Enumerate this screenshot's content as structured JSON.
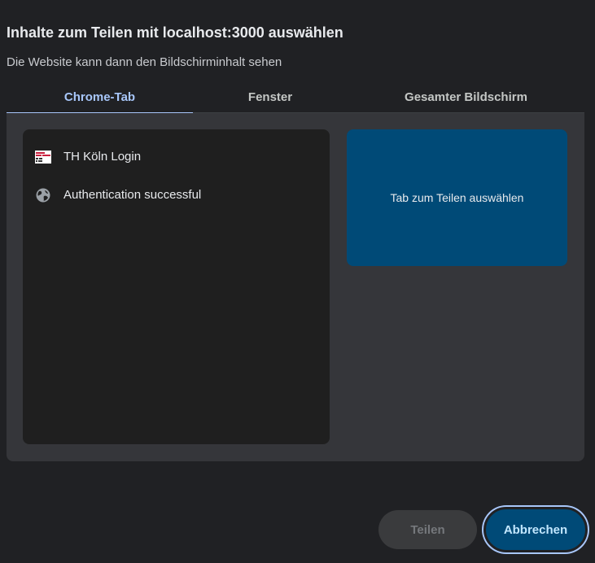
{
  "dialog": {
    "title": "Inhalte zum Teilen mit localhost:3000 auswählen",
    "subtitle": "Die Website kann dann den Bildschirminhalt sehen"
  },
  "tabs": [
    {
      "label": "Chrome-Tab",
      "active": true
    },
    {
      "label": "Fenster",
      "active": false
    },
    {
      "label": "Gesamter Bildschirm",
      "active": false
    }
  ],
  "tab_list": [
    {
      "title": "TH Köln Login",
      "icon": "th-koeln-favicon"
    },
    {
      "title": "Authentication successful",
      "icon": "globe-icon"
    }
  ],
  "preview": {
    "placeholder": "Tab zum Teilen auswählen"
  },
  "buttons": {
    "share_label": "Teilen",
    "cancel_label": "Abbrechen"
  },
  "colors": {
    "background": "#202124",
    "panel": "#35363a",
    "list": "#1f1f1f",
    "accent": "#a8c7fa",
    "preview": "#004a77"
  }
}
